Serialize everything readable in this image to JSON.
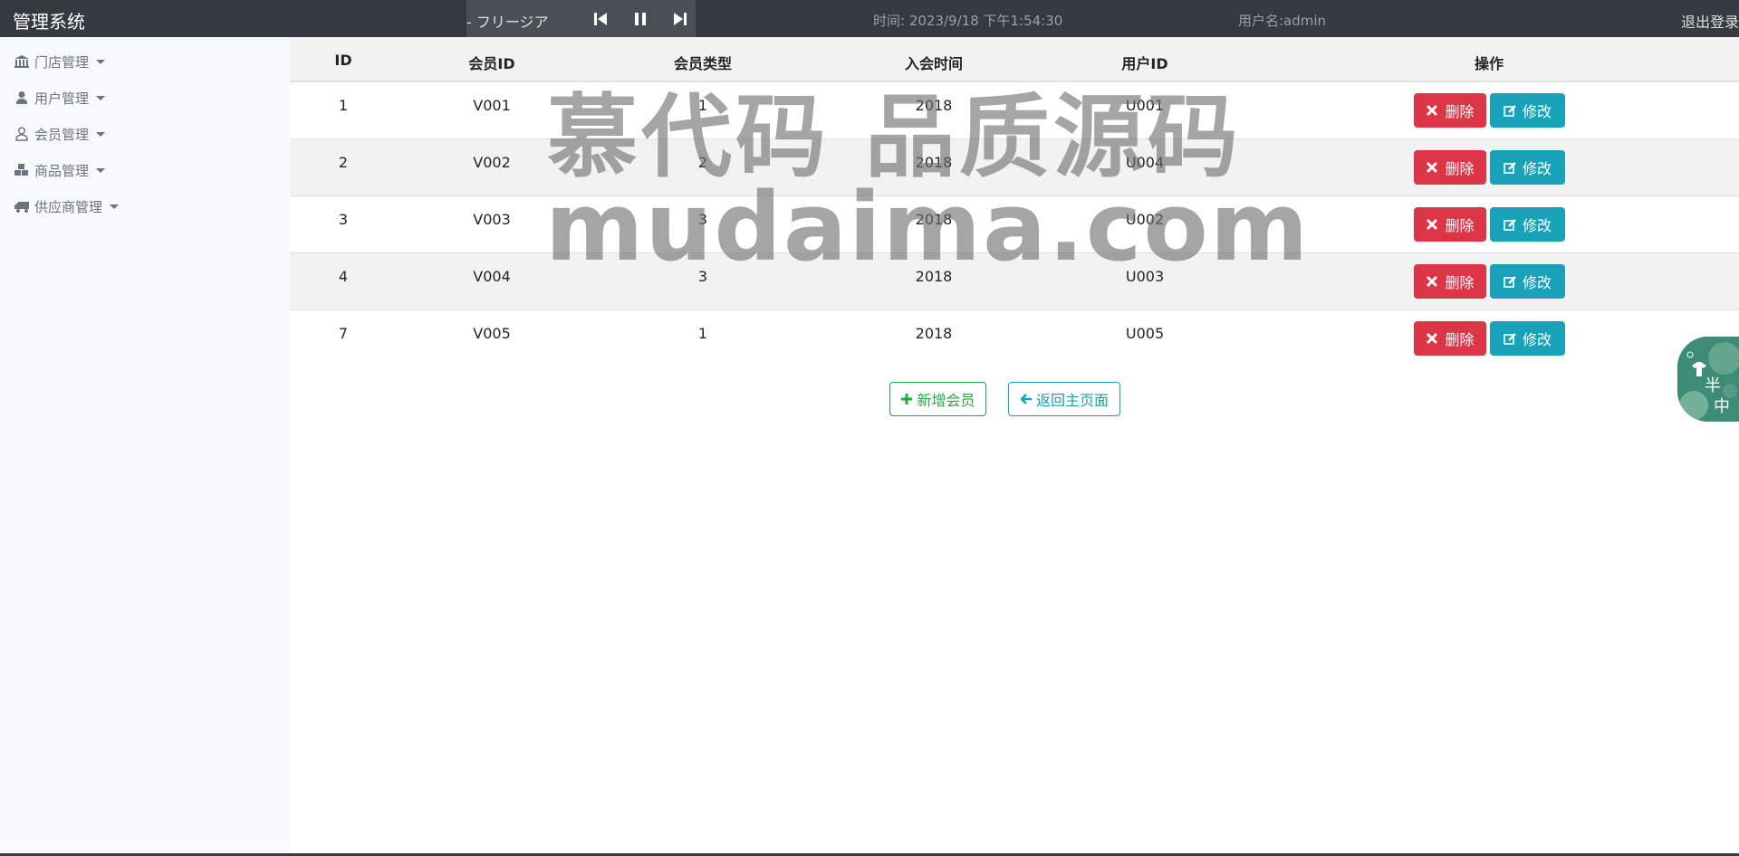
{
  "navbar": {
    "brand": "管理系统",
    "player": {
      "song": "- フリージア",
      "prev_icon": "step-backward-icon",
      "pause_icon": "pause-icon",
      "next_icon": "step-forward-icon"
    },
    "time": "时间: 2023/9/18 下午1:54:30",
    "user": "用户名:admin",
    "logout": "退出登录"
  },
  "sidebar": {
    "items": [
      {
        "label": "门店管理",
        "icon": "bank-icon"
      },
      {
        "label": "用户管理",
        "icon": "user-icon"
      },
      {
        "label": "会员管理",
        "icon": "user-outline-icon"
      },
      {
        "label": "商品管理",
        "icon": "cubes-icon"
      },
      {
        "label": "供应商管理",
        "icon": "truck-icon"
      }
    ]
  },
  "table": {
    "headers": [
      "ID",
      "会员ID",
      "会员类型",
      "入会时间",
      "用户ID",
      "操作"
    ],
    "rows": [
      {
        "id": "1",
        "member_id": "V001",
        "type": "1",
        "join": "2018",
        "user_id": "U001"
      },
      {
        "id": "2",
        "member_id": "V002",
        "type": "2",
        "join": "2018",
        "user_id": "U004"
      },
      {
        "id": "3",
        "member_id": "V003",
        "type": "3",
        "join": "2018",
        "user_id": "U002"
      },
      {
        "id": "4",
        "member_id": "V004",
        "type": "3",
        "join": "2018",
        "user_id": "U003"
      },
      {
        "id": "7",
        "member_id": "V005",
        "type": "1",
        "join": "2018",
        "user_id": "U005"
      }
    ],
    "delete_label": "删除",
    "edit_label": "修改"
  },
  "actions": {
    "add_label": "新增会员",
    "back_label": "返回主页面"
  },
  "watermark": {
    "line1": "慕代码 品质源码",
    "line2": "mudaima.com"
  },
  "widget": {
    "text1": "半",
    "text2": "中"
  },
  "colors": {
    "navbar": "#343a40",
    "danger": "#dc3545",
    "info": "#17a2b8",
    "success": "#28a745",
    "sidebar": "#f8f9fa"
  }
}
